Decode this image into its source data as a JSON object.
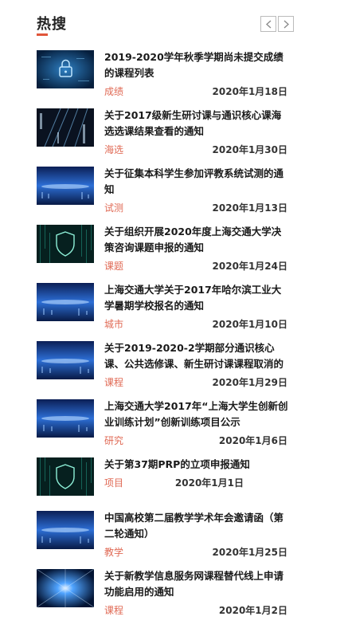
{
  "header": {
    "title": "热搜",
    "prev_icon": "chevron-left-icon",
    "next_icon": "chevron-right-icon"
  },
  "colors": {
    "accent": "#e0563a",
    "tag": "#e06a55"
  },
  "items": [
    {
      "title": "2019-2020学年秋季学期尚未提交成绩的课程列表",
      "tag": "成绩",
      "date": "2020年1月18日",
      "thumb": "lock-image"
    },
    {
      "title": "关于2017级新生研讨课与通识核心课海选选课结果查看的通知",
      "tag": "海选",
      "date": "2020年1月30日",
      "thumb": "data-image"
    },
    {
      "title": "关于征集本科学生参加评教系统试测的通知",
      "tag": "试测",
      "date": "2020年1月13日",
      "thumb": "blue-tech-image"
    },
    {
      "title": "关于组织开展2020年度上海交通大学决策咨询课题申报的通知",
      "tag": "课题",
      "date": "2020年1月24日",
      "thumb": "shield-image"
    },
    {
      "title": "上海交通大学关于2017年哈尔滨工业大学暑期学校报名的通知",
      "tag": "城市",
      "date": "2020年1月10日",
      "thumb": "blue-tech-image"
    },
    {
      "title": "关于2019-2020-2学期部分通识核心课、公共选修课、新生研讨课课程取消的通知",
      "tag": "课程",
      "date": "2020年1月29日",
      "thumb": "blue-tech-image"
    },
    {
      "title": "上海交通大学2017年“上海大学生创新创业训练计划”创新训练项目公示",
      "tag": "研究",
      "date": "2020年1月6日",
      "thumb": "blue-tech-image"
    },
    {
      "title": "关于第37期PRP的立项申报通知",
      "tag": "项目",
      "date": "2020年1月1日",
      "thumb": "shield-image"
    },
    {
      "title": "中国高校第二届教学学术年会邀请函（第二轮通知）",
      "tag": "教学",
      "date": "2020年1月25日",
      "thumb": "blue-tech-image"
    },
    {
      "title": "关于新教学信息服务网课程替代线上申请功能启用的通知",
      "tag": "课程",
      "date": "2020年1月2日",
      "thumb": "light-burst-image"
    }
  ]
}
